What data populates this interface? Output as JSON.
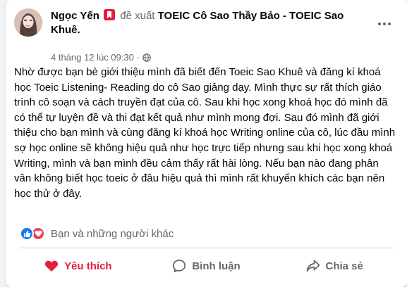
{
  "post": {
    "author": "Ngọc Yến",
    "verb": "đề xuất",
    "page": "TOEIC Cô Sao Thầy Bảo - TOEIC Sao Khuê",
    "page_suffix": ".",
    "timestamp": "4 tháng 12 lúc 09:30",
    "separator": "·",
    "body": "Nhờ được bạn bè giới thiệu mình đã biết đến Toeic Sao Khuê và đăng kí khoá học Toeic Listening- Reading do cô Sao giảng dạy. Mình thực sự rất thích giáo trình cô soạn và cách truyền đạt của cô. Sau khi học xong khoá học đó mình đã có thể tự luyện đề và thi đạt kết quả như mình mong đợi. Sau đó mình đã giới thiệu cho bạn mình và cùng đăng kí khoá học Writing online của cô, lúc đầu mình sợ học online sẽ không hiệu quả như học trực tiếp nhưng sau khi học xong khoá Writing, mình và bạn mình đều cảm thấy rất hài lòng. Nếu bạn nào đang phân vân không biết học toeic ở đâu hiệu quả thì mình rất khuyến khích các bạn nên học thử ở đây."
  },
  "reactions": {
    "icons": [
      "like-icon",
      "love-icon"
    ],
    "text": "Bạn và những người khác"
  },
  "actions": {
    "like_label": "Yêu thích",
    "comment_label": "Bình luận",
    "share_label": "Chia sẻ"
  },
  "colors": {
    "like_active": "#e41e3f",
    "secondary_text": "#65676b",
    "like_blue": "#1877f2",
    "love_red": "#f33e58"
  }
}
